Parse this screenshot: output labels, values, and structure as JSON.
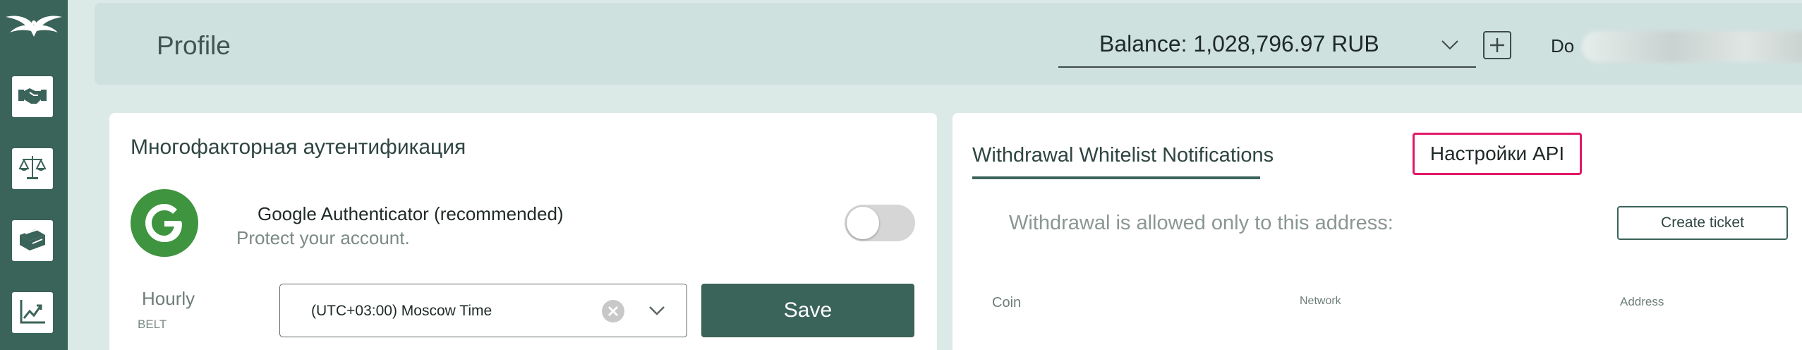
{
  "header": {
    "title": "Profile",
    "balance": "Balance: 1,028,796.97 RUB",
    "user_prefix": "Do"
  },
  "sidebar": {
    "items": [
      {
        "icon": "handshake-icon"
      },
      {
        "icon": "scales-icon"
      },
      {
        "icon": "money-icon"
      },
      {
        "icon": "chart-icon"
      }
    ]
  },
  "mfa": {
    "title": "Многофакторная аутентификация",
    "authenticator_name": "Google Authenticator (recommended)",
    "authenticator_desc": "Protect your account.",
    "toggle_on": false,
    "schedule_label": "Hourly",
    "belt_label": "BELT",
    "timezone_value": "(UTC+03:00) Moscow Time",
    "save_label": "Save"
  },
  "whitelist": {
    "tabs": [
      {
        "label": "Withdrawal Whitelist Notifications",
        "active": true
      },
      {
        "label": "Настройки API",
        "active": false
      }
    ],
    "note": "Withdrawal is allowed only to this address:",
    "create_ticket_label": "Create ticket",
    "columns": [
      "Coin",
      "Network",
      "Address"
    ]
  },
  "colors": {
    "brand": "#3a6359",
    "background": "#dbe9e7",
    "header_bg": "#cfe1de",
    "highlight": "#e0196a",
    "google_green": "#3f9440"
  }
}
